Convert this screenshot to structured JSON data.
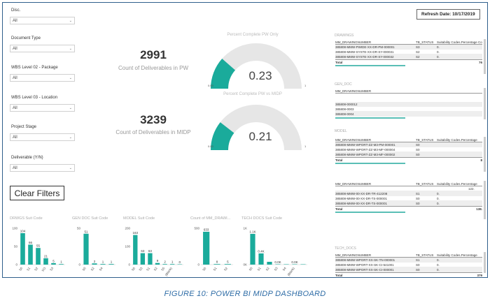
{
  "slicers": [
    {
      "title": "Disc.",
      "value": "All"
    },
    {
      "title": "Document Type",
      "value": "All"
    },
    {
      "title": "WBS Level 02 - Package",
      "value": "All"
    },
    {
      "title": "WBS Level 03 - Location",
      "value": "All"
    },
    {
      "title": "Project Stage",
      "value": "All"
    },
    {
      "title": "Deliverable (Y/N)",
      "value": "All"
    }
  ],
  "clear_filters": "Clear Filters",
  "kpis": [
    {
      "value": "2991",
      "label": "Count of Deliverables in PW"
    },
    {
      "value": "3239",
      "label": "Count of Deliverables in MIDP"
    }
  ],
  "gauges": [
    {
      "title": "Percent Complete PW Only",
      "value": "0.23",
      "fraction": 0.23,
      "min": "0.00",
      "max": "1"
    },
    {
      "title": "Percent Complete PW vs MIDP",
      "value": "0.21",
      "fraction": 0.21,
      "min": "0.00",
      "max": "1"
    }
  ],
  "refresh": "Refresh Date: 10/17/2019",
  "tables": {
    "drawings": {
      "title": "DRAWINGS",
      "headers": [
        "MM_DRAWINGNUMBER",
        "TB_STATUS",
        "Suitability Codes.Percentage Complete"
      ],
      "rows": [
        [
          "385808-MMW-PWIDE-XX-DR-PM-000001",
          "S3",
          "0."
        ],
        [
          "385808-MMW-SYSTE-XX-DR-SY-000031",
          "S2",
          "0."
        ],
        [
          "385808-MMW-SYSTE-XX-DR-SY-000032",
          "S2",
          "0."
        ]
      ],
      "total_label": "Total",
      "total_value": "76"
    },
    "gen_doc": {
      "title": "GEN_DOC",
      "headers": [
        "MM_DRAWINGNUMBER"
      ],
      "rows": [
        [
          "385808-000012"
        ],
        [
          "385808-0003"
        ],
        [
          "385808-0004"
        ]
      ]
    },
    "model": {
      "title": "MODEL",
      "headers": [
        "MM_DRAWINGNUMBER",
        "TB_STATUS",
        "Suitability Codes.Percentage"
      ],
      "rows": [
        [
          "385808-MMW-WPORT-ZZ-M3-PM-000001",
          "S0",
          ""
        ],
        [
          "385808-MMW-WPORT-ZZ-M3-MF-000004",
          "S0",
          ""
        ],
        [
          "385808-MMW-WPORT-ZZ-M3-MF-000002",
          "S0",
          ""
        ]
      ],
      "total_label": "Total",
      "total_value": "8"
    },
    "other": {
      "headers": [
        "MM_DRAWINGNUMBER",
        "TB_STATUS",
        "Suitability Codes.Percentage"
      ],
      "first_value": "122.",
      "rows": [
        [
          "385808-MMW-00-XX-DR-TR-412208",
          "S1",
          "0."
        ],
        [
          "385808-MMW-00-XX-DR-TS-000001",
          "S0",
          "0."
        ],
        [
          "385808-MMW-00-XX-DR-TS-000001",
          "S0",
          "0."
        ]
      ],
      "total_label": "Total",
      "total_value": "138."
    },
    "tech_docs": {
      "title": "TECH_DOCS",
      "headers": [
        "MM_DRAWINGNUMBER",
        "TB_STATUS",
        "Suitability Codes.Percentage"
      ],
      "rows": [
        [
          "385808-MMW-WPORT-XX-SK-TN-000001",
          "S1",
          "0."
        ],
        [
          "385808-MMW-WPORT-XX-SK-CI-541001",
          "S0",
          "0."
        ],
        [
          "385808-MMW-WPORT-XX-SK-CI-000001",
          "S0",
          "0."
        ]
      ],
      "total_label": "Total",
      "total_value": "379"
    }
  },
  "caption": "FIGURE 10: POWER BI MIDP DASHBOARD",
  "colors": {
    "accent": "#1aab9b",
    "frame": "#2f5f8c",
    "caption": "#2e6ca6"
  },
  "chart_data": [
    {
      "type": "bar",
      "title": "DRWGS Suit Code",
      "categories": [
        "S0",
        "S1",
        "S2",
        "SO",
        "S3"
      ],
      "values": [
        104,
        66,
        55,
        21,
        5,
        1
      ],
      "value_labels": [
        "104",
        "66",
        "55",
        "21",
        "5",
        "1"
      ],
      "tick_labels": [
        "S0",
        "S1",
        "S2",
        "SO",
        "S3"
      ],
      "yticks": [
        "100",
        "50",
        "0"
      ],
      "ylim": [
        0,
        120
      ]
    },
    {
      "type": "bar",
      "title": "GEN DOC Suit Code",
      "categories": [
        "S0",
        "S2",
        "S4"
      ],
      "values": [
        51,
        2,
        1,
        1
      ],
      "value_labels": [
        "51",
        "2",
        "1",
        "1"
      ],
      "tick_labels": [
        "S0",
        "S2",
        "S4"
      ],
      "yticks": [
        "50",
        "0"
      ],
      "ylim": [
        0,
        60
      ]
    },
    {
      "type": "bar",
      "title": "MODEL Suit Code",
      "categories": [
        "S0",
        "S3",
        "S1",
        "S2",
        "S5",
        "(Blank)"
      ],
      "values": [
        163,
        63,
        63,
        9,
        2,
        1,
        0
      ],
      "value_labels": [
        "163",
        "63",
        "63",
        "9",
        "2",
        "1",
        "0"
      ],
      "tick_labels": [
        "S0",
        "S3",
        "S1",
        "S2",
        "S5",
        "(Blank)"
      ],
      "yticks": [
        "200",
        "100",
        "0"
      ],
      "ylim": [
        0,
        200
      ]
    },
    {
      "type": "bar",
      "title": "Count of MM_DRAWI...",
      "categories": [
        "S0",
        "S1",
        "S2"
      ],
      "values": [
        633,
        8,
        5
      ],
      "value_labels": [
        "633",
        "8",
        "5"
      ],
      "tick_labels": [
        "S0",
        "S1",
        "S2"
      ],
      "yticks": [
        "500",
        "0"
      ],
      "ylim": [
        0,
        700
      ]
    },
    {
      "type": "bar",
      "title": "TECH DOCS Suit Code",
      "categories": [
        "S0",
        "S1",
        "S2",
        "S3",
        "S4",
        "(Blank)"
      ],
      "values": [
        1100,
        400,
        100,
        0,
        0,
        0,
        0
      ],
      "value_labels": [
        "1.1K",
        "0.4K",
        "",
        "0.0K",
        "",
        "0.0K",
        ""
      ],
      "tick_labels": [
        "S0",
        "S1",
        "S2",
        "S3",
        "S4",
        "(Blank)"
      ],
      "yticks": [
        "1K",
        "0K"
      ],
      "ylim": [
        0,
        1300
      ]
    }
  ]
}
